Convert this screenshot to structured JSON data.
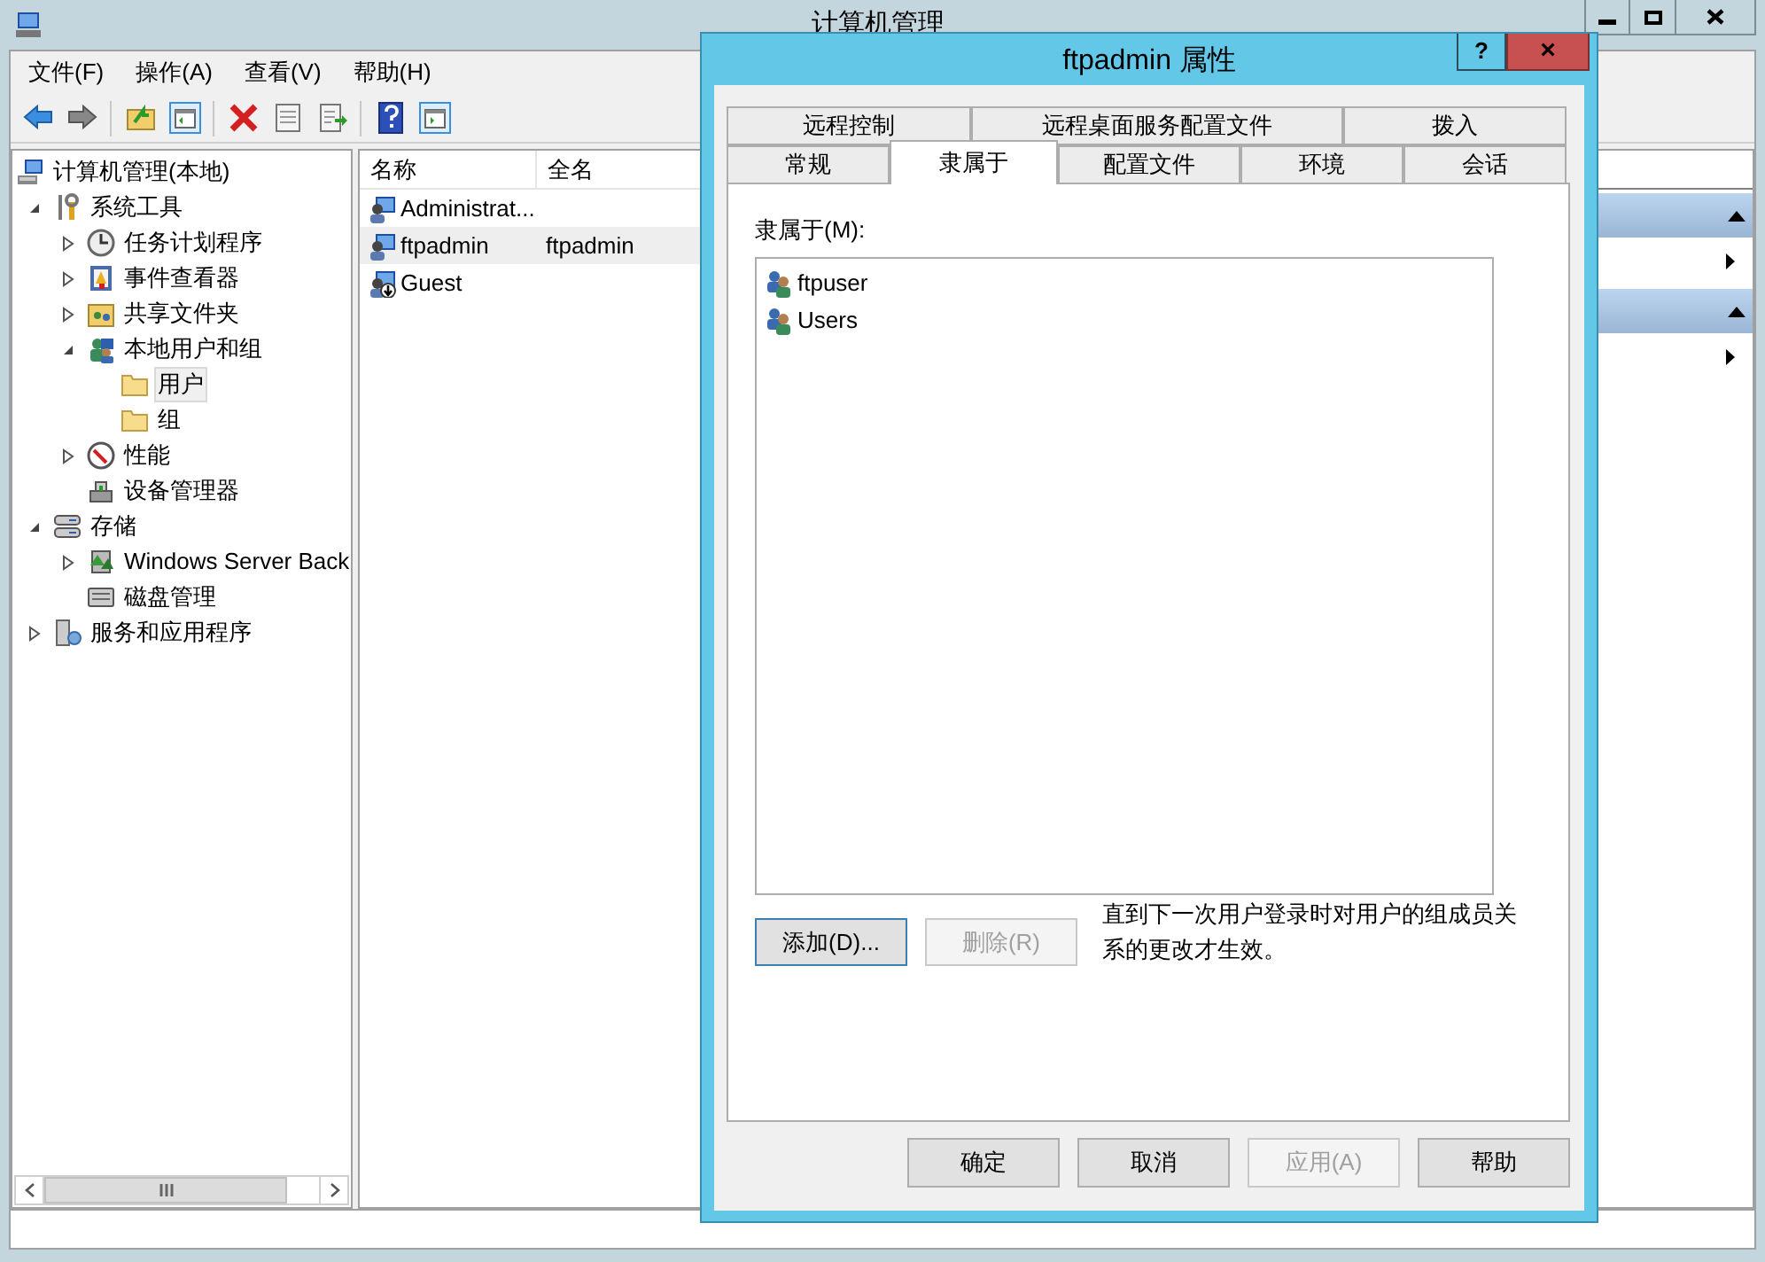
{
  "window": {
    "title": "计算机管理"
  },
  "menu": [
    "文件(F)",
    "操作(A)",
    "查看(V)",
    "帮助(H)"
  ],
  "tree": [
    {
      "label": "计算机管理(本地)",
      "kind": "computer",
      "selected": false,
      "children": [
        {
          "label": "系统工具",
          "kind": "tools",
          "selected": false,
          "expanded": true,
          "children": [
            {
              "label": "任务计划程序",
              "kind": "clock",
              "selected": false,
              "expanded": false
            },
            {
              "label": "事件查看器",
              "kind": "event",
              "selected": false,
              "expanded": false
            },
            {
              "label": "共享文件夹",
              "kind": "share",
              "selected": false,
              "expanded": false
            },
            {
              "label": "本地用户和组",
              "kind": "users",
              "selected": false,
              "expanded": true,
              "children": [
                {
                  "label": "用户",
                  "kind": "folder",
                  "selected": true
                },
                {
                  "label": "组",
                  "kind": "folder",
                  "selected": false
                }
              ]
            },
            {
              "label": "性能",
              "kind": "perf",
              "selected": false,
              "expanded": false
            },
            {
              "label": "设备管理器",
              "kind": "device",
              "selected": false
            }
          ]
        },
        {
          "label": "存储",
          "kind": "storage",
          "selected": false,
          "expanded": true,
          "children": [
            {
              "label": "Windows Server Back",
              "kind": "backup",
              "selected": false,
              "expanded": false
            },
            {
              "label": "磁盘管理",
              "kind": "disk",
              "selected": false
            }
          ]
        },
        {
          "label": "服务和应用程序",
          "kind": "services",
          "selected": false,
          "expanded": false
        }
      ]
    }
  ],
  "list": {
    "columns": [
      "名称",
      "全名"
    ],
    "rows": [
      {
        "name": "Administrat...",
        "full_name": "",
        "selected": false,
        "disabled": false
      },
      {
        "name": "ftpadmin",
        "full_name": "ftpadmin",
        "selected": true,
        "disabled": false
      },
      {
        "name": "Guest",
        "full_name": "",
        "selected": false,
        "disabled": true
      }
    ]
  },
  "dialog": {
    "title": "ftpadmin 属性",
    "help": "?",
    "close": "×",
    "tab_rows": [
      [
        {
          "label": "远程控制",
          "selected": false
        },
        {
          "label": "远程桌面服务配置文件",
          "selected": false
        },
        {
          "label": "拨入",
          "selected": false
        }
      ],
      [
        {
          "label": "常规",
          "selected": false
        },
        {
          "label": "隶属于",
          "selected": true
        },
        {
          "label": "配置文件",
          "selected": false
        },
        {
          "label": "环境",
          "selected": false
        },
        {
          "label": "会话",
          "selected": false
        }
      ]
    ],
    "member_label": "隶属于(M):",
    "members": [
      "ftpuser",
      "Users"
    ],
    "actions": [
      {
        "label": "添加(D)...",
        "disabled": false,
        "focused": true
      },
      {
        "label": "删除(R)",
        "disabled": true,
        "focused": false
      }
    ],
    "note": "直到下一次用户登录时对用户的组成员关系的更改才生效。",
    "buttons": [
      {
        "label": "确定",
        "disabled": false
      },
      {
        "label": "取消",
        "disabled": false
      },
      {
        "label": "应用(A)",
        "disabled": true
      },
      {
        "label": "帮助",
        "disabled": false
      }
    ]
  }
}
